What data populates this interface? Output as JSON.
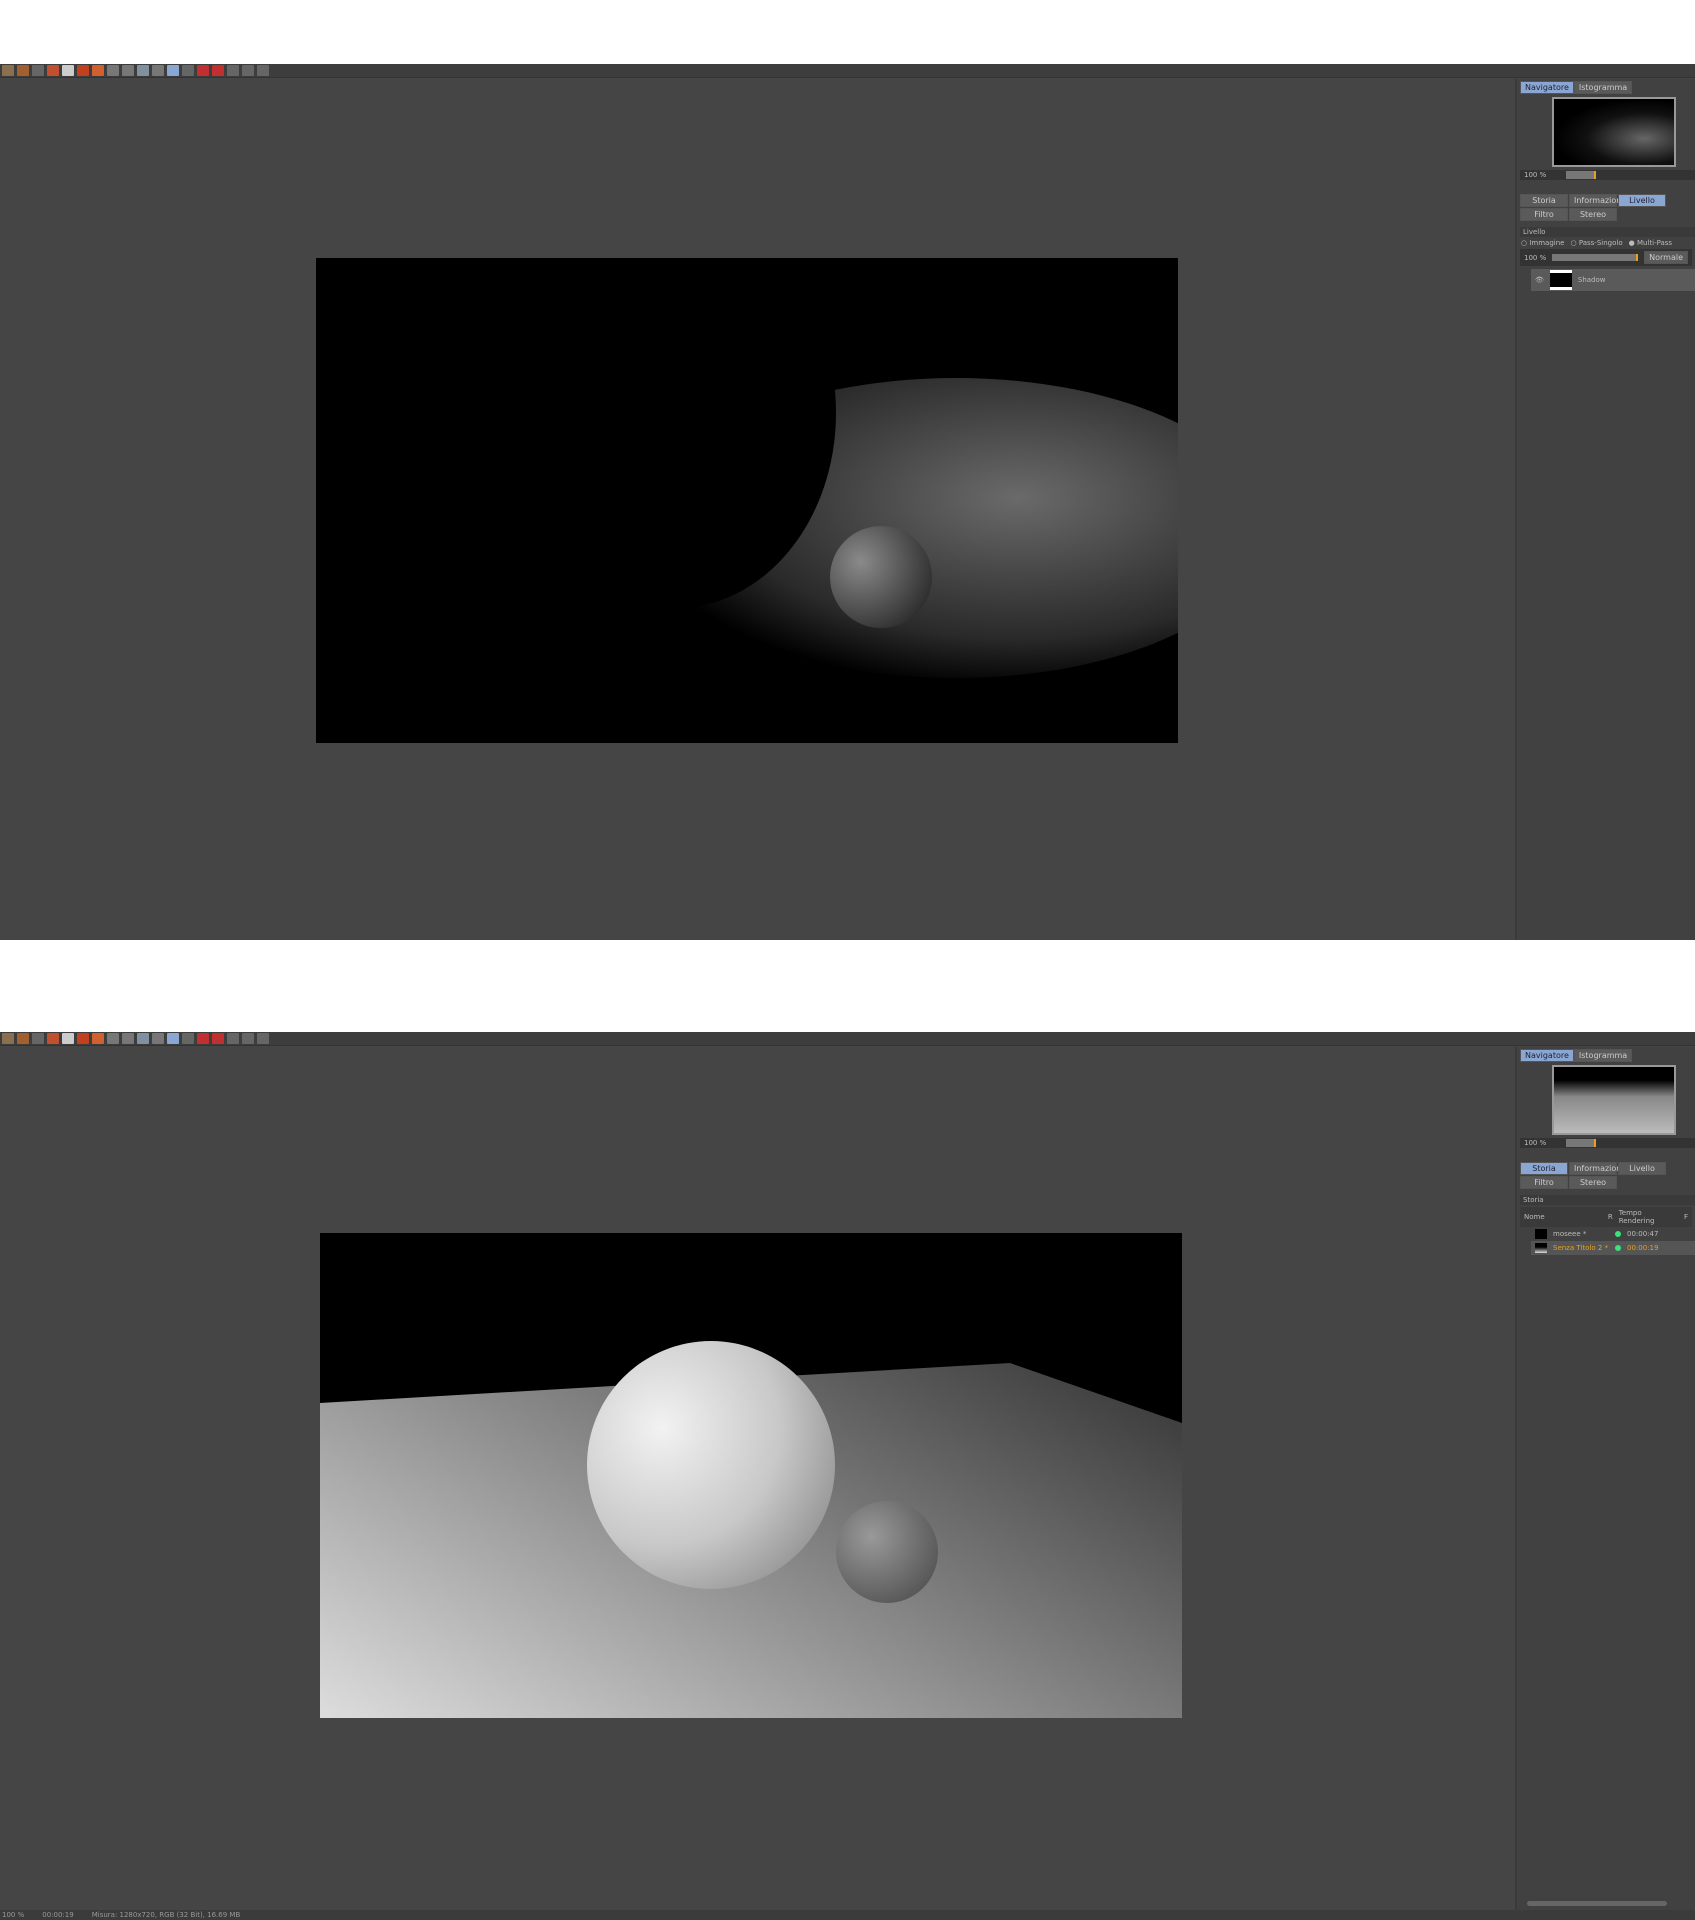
{
  "windows": [
    {
      "navigator": {
        "tabs": [
          "Navigatore",
          "Istogramma"
        ],
        "active": 0,
        "zoom": "100 %"
      },
      "panel_tabs": [
        "Storia",
        "Informazioni",
        "Livello",
        "Filtro",
        "Stereo"
      ],
      "active_tab": "Livello",
      "livello": {
        "title": "Livello",
        "modes": [
          "Immagine",
          "Pass-Singolo",
          "Multi-Pass"
        ],
        "selected_mode": "Multi-Pass",
        "opacity": "100 %",
        "blend": "Normale",
        "layers": [
          {
            "name": "Shadow"
          }
        ]
      }
    },
    {
      "navigator": {
        "tabs": [
          "Navigatore",
          "Istogramma"
        ],
        "active": 0,
        "zoom": "100 %"
      },
      "panel_tabs": [
        "Storia",
        "Informazioni",
        "Livello",
        "Filtro",
        "Stereo"
      ],
      "active_tab": "Storia",
      "storia": {
        "title": "Storia",
        "columns": [
          "Nome",
          "R",
          "Tempo Rendering",
          "F"
        ],
        "rows": [
          {
            "name": "moseee *",
            "time": "00:00:47",
            "status_color": "#3de07a"
          },
          {
            "name": "Senza Titolo 2 *",
            "time": "00:00:19",
            "status_color": "#3de07a",
            "highlight": "#e8a020"
          }
        ]
      },
      "status": {
        "zoom": "100 %",
        "time": "00:00:19",
        "info": "Misura: 1280x720, RGB (32 Bit), 16.69 MB"
      }
    }
  ],
  "toolbar_icons": [
    "open-icon",
    "save-icon",
    "grid-icon",
    "align-icon",
    "user-icon",
    "copy-icon",
    "paste-icon",
    "render-region-icon",
    "render-icon",
    "render-settings-icon",
    "compare-icon",
    "split-icon",
    "ab-icon",
    "a-icon",
    "b-icon",
    "tool1-icon",
    "tool2-icon",
    "tool3-icon"
  ]
}
